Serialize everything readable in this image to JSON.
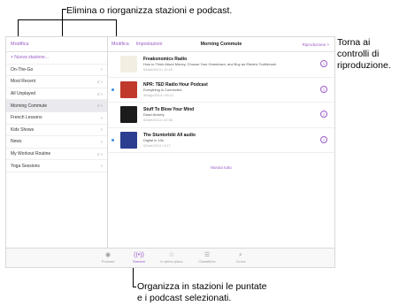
{
  "callouts": {
    "top": "Elimina o riorganizza stazioni e podcast.",
    "right": [
      "Torna ai",
      "controlli di",
      "riproduzione."
    ],
    "bottom": [
      "Organizza in stazioni le puntate",
      "e i podcast selezionati."
    ]
  },
  "sidebar": {
    "edit_label": "Modifica",
    "items": [
      {
        "label": "+ Nuova stazione...",
        "counts": ""
      },
      {
        "label": "On-The-Go",
        "counts": ">"
      },
      {
        "label": "Most Recent",
        "counts": "4  >"
      },
      {
        "label": "All Unplayed",
        "counts": "4  >"
      },
      {
        "label": "Morning Commute",
        "counts": "4  >",
        "selected": true
      },
      {
        "label": "French Lessons",
        "counts": ">"
      },
      {
        "label": "Kids Shows",
        "counts": ">"
      },
      {
        "label": "News",
        "counts": ">"
      },
      {
        "label": "My Workout Routine",
        "counts": "2  >"
      },
      {
        "label": "Yoga Sessions",
        "counts": ">"
      }
    ]
  },
  "main": {
    "edit_label": "Modifica",
    "settings_label": "Impostazioni",
    "title": "Morning Commute",
    "now_playing": "Riproduzione >",
    "episodes": [
      {
        "title": "Freakonomics Radio",
        "subtitle": "How to Think About Money, Choose Your Hometown, and Buy an Electric Toothbrush",
        "meta": "02/set/2013 • 12:15",
        "art_color": "#f2efe2",
        "unplayed": false
      },
      {
        "title": "NPR: TED Radio Hour Podcast",
        "subtitle": "Everything is Connected",
        "meta": "30/ago/2013 • 50:21",
        "art_color": "#c0392b",
        "unplayed": true
      },
      {
        "title": "Stuff To Blow Your Mind",
        "subtitle": "Dead Anxiety",
        "meta": "02/set/2013 • 22:38",
        "art_color": "#1b1b1b",
        "unplayed": false
      },
      {
        "title": "The Stuntorbiki All audio",
        "subtitle": "Digital in 10s",
        "meta": "02/set/2013 • 5:17",
        "art_color": "#2c3e8f",
        "unplayed": true
      }
    ],
    "show_all": "Mostra tutto"
  },
  "tabbar": {
    "items": [
      {
        "label": "Podcast",
        "icon": "podcast-icon",
        "glyph": "◉"
      },
      {
        "label": "Stazioni",
        "icon": "stations-icon",
        "glyph": "((•))",
        "active": true
      },
      {
        "label": "In primo piano",
        "icon": "featured-icon",
        "glyph": "☆"
      },
      {
        "label": "Classifiche",
        "icon": "charts-icon",
        "glyph": "☰"
      },
      {
        "label": "Cerca",
        "icon": "search-icon",
        "glyph": "⌕"
      }
    ]
  },
  "colors": {
    "accent": "#9b5bc6",
    "unplayed_dot": "#3a8ee6"
  }
}
